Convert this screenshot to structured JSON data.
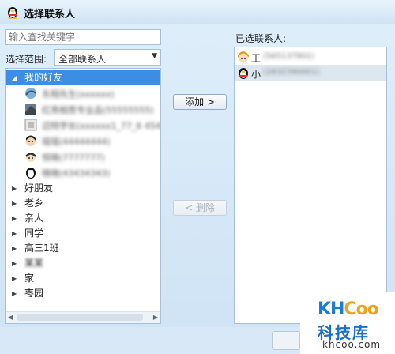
{
  "window": {
    "title": "选择联系人",
    "icon": "qq-penguin-icon"
  },
  "search": {
    "placeholder": "输入查找关键字"
  },
  "scope": {
    "label": "选择范围:",
    "selected": "全部联系人",
    "icon": "chevron-down-icon"
  },
  "tree": {
    "expanded_group": "我的好友",
    "contacts": [
      {
        "avatar": "avatar-1-icon",
        "name": "东翔先生(xxxxxx)"
      },
      {
        "avatar": "avatar-2-icon",
        "name": "红亮相思专业品(55555555)"
      },
      {
        "avatar": "avatar-3-icon",
        "name": "迈特学长(xxxxxx1_77_6 45454)"
      },
      {
        "avatar": "avatar-4-icon",
        "name": "瑶瑶(44444444)"
      },
      {
        "avatar": "avatar-5-icon",
        "name": "悦晓(7777777)"
      },
      {
        "avatar": "avatar-6-icon",
        "name": "晓晓(43434343)"
      }
    ],
    "groups": [
      "好朋友",
      "老乡",
      "亲人",
      "同学",
      "高三1班",
      "某某",
      "家",
      "枣园"
    ]
  },
  "buttons": {
    "add": "添加 >",
    "remove": "< 删除"
  },
  "selected": {
    "label": "已选联系人:",
    "items": [
      {
        "avatar": "avatar-girl-icon",
        "name": "王",
        "detail": "(565137801)"
      },
      {
        "avatar": "avatar-penguin-icon",
        "name": "小",
        "detail": "(2832390001)"
      }
    ]
  },
  "watermark": {
    "logo_k": "KH",
    "logo_c": "Coo",
    "name": "科技库",
    "url": "khcoo.com"
  },
  "colors": {
    "selection": "#3a8ee6",
    "window_bg": "#d6e7f6"
  }
}
